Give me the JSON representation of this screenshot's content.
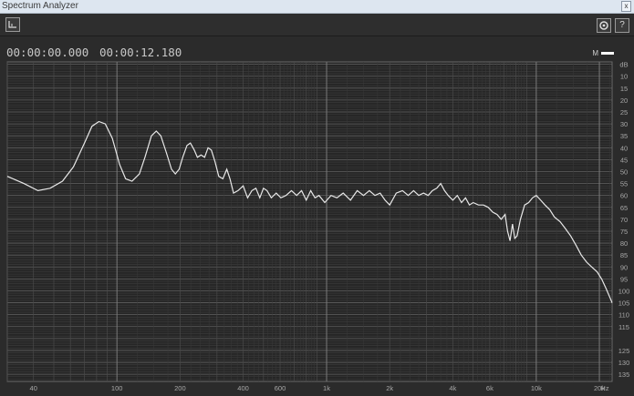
{
  "window": {
    "title": "Spectrum Analyzer",
    "close_label": "x"
  },
  "toolbar": {
    "left_icon": "waveform-icon",
    "settings_icon": "gear-icon",
    "help_label": "?"
  },
  "readout": {
    "start_time": "00:00:00.000",
    "end_time": "00:00:12.180"
  },
  "legend": {
    "label": "M"
  },
  "colors": {
    "background": "#2b2b2b",
    "grid": "#5c5c5c",
    "trace": "#e8e8e8",
    "label": "#a8a8a8"
  },
  "chart_data": {
    "type": "line",
    "x_scale": "log",
    "y_scale": "linear",
    "xlim": [
      30,
      23000
    ],
    "ylim": [
      -138,
      -4
    ],
    "x_ticks": [
      {
        "value": 40,
        "label": "40"
      },
      {
        "value": 100,
        "label": "100"
      },
      {
        "value": 200,
        "label": "200"
      },
      {
        "value": 400,
        "label": "400"
      },
      {
        "value": 600,
        "label": "600"
      },
      {
        "value": 1000,
        "label": "1k"
      },
      {
        "value": 2000,
        "label": "2k"
      },
      {
        "value": 4000,
        "label": "4k"
      },
      {
        "value": 6000,
        "label": "6k"
      },
      {
        "value": 10000,
        "label": "10k"
      },
      {
        "value": 20000,
        "label": "20k"
      }
    ],
    "x_unit": "Hz",
    "y_ticks": [
      {
        "value": -5,
        "label": "dB"
      },
      {
        "value": -10,
        "label": "10"
      },
      {
        "value": -15,
        "label": "15"
      },
      {
        "value": -20,
        "label": "20"
      },
      {
        "value": -25,
        "label": "25"
      },
      {
        "value": -30,
        "label": "30"
      },
      {
        "value": -35,
        "label": "35"
      },
      {
        "value": -40,
        "label": "40"
      },
      {
        "value": -45,
        "label": "45"
      },
      {
        "value": -50,
        "label": "50"
      },
      {
        "value": -55,
        "label": "55"
      },
      {
        "value": -60,
        "label": "60"
      },
      {
        "value": -65,
        "label": "65"
      },
      {
        "value": -70,
        "label": "70"
      },
      {
        "value": -75,
        "label": "75"
      },
      {
        "value": -80,
        "label": "80"
      },
      {
        "value": -85,
        "label": "85"
      },
      {
        "value": -90,
        "label": "90"
      },
      {
        "value": -95,
        "label": "95"
      },
      {
        "value": -100,
        "label": "100"
      },
      {
        "value": -105,
        "label": "105"
      },
      {
        "value": -110,
        "label": "110"
      },
      {
        "value": -115,
        "label": "115"
      },
      {
        "value": -125,
        "label": "125"
      },
      {
        "value": -130,
        "label": "130"
      },
      {
        "value": -135,
        "label": "135"
      }
    ],
    "grid": true,
    "series": [
      {
        "points": [
          [
            30,
            -52
          ],
          [
            36,
            -55
          ],
          [
            42,
            -58
          ],
          [
            48,
            -57
          ],
          [
            55,
            -54
          ],
          [
            62,
            -48
          ],
          [
            70,
            -38
          ],
          [
            76,
            -31
          ],
          [
            82,
            -29
          ],
          [
            88,
            -30
          ],
          [
            95,
            -36
          ],
          [
            103,
            -47
          ],
          [
            110,
            -53
          ],
          [
            118,
            -54
          ],
          [
            128,
            -51
          ],
          [
            136,
            -44
          ],
          [
            146,
            -35
          ],
          [
            154,
            -33
          ],
          [
            162,
            -35
          ],
          [
            172,
            -42
          ],
          [
            182,
            -49
          ],
          [
            190,
            -51
          ],
          [
            198,
            -49
          ],
          [
            206,
            -44
          ],
          [
            216,
            -39
          ],
          [
            224,
            -38
          ],
          [
            234,
            -41
          ],
          [
            242,
            -44
          ],
          [
            252,
            -43
          ],
          [
            262,
            -44
          ],
          [
            272,
            -40
          ],
          [
            282,
            -41
          ],
          [
            294,
            -46
          ],
          [
            306,
            -52
          ],
          [
            320,
            -53
          ],
          [
            334,
            -49
          ],
          [
            346,
            -53
          ],
          [
            360,
            -59
          ],
          [
            378,
            -58
          ],
          [
            400,
            -56
          ],
          [
            420,
            -61
          ],
          [
            440,
            -58
          ],
          [
            460,
            -57
          ],
          [
            480,
            -61
          ],
          [
            500,
            -57
          ],
          [
            520,
            -58
          ],
          [
            545,
            -61
          ],
          [
            575,
            -59
          ],
          [
            605,
            -61
          ],
          [
            640,
            -60
          ],
          [
            680,
            -58
          ],
          [
            720,
            -60
          ],
          [
            760,
            -58
          ],
          [
            800,
            -62
          ],
          [
            840,
            -58
          ],
          [
            880,
            -61
          ],
          [
            920,
            -60
          ],
          [
            980,
            -63
          ],
          [
            1050,
            -60
          ],
          [
            1120,
            -61
          ],
          [
            1200,
            -59
          ],
          [
            1300,
            -62
          ],
          [
            1400,
            -58
          ],
          [
            1500,
            -60
          ],
          [
            1600,
            -58
          ],
          [
            1700,
            -60
          ],
          [
            1800,
            -59
          ],
          [
            1900,
            -62
          ],
          [
            2000,
            -64
          ],
          [
            2150,
            -59
          ],
          [
            2300,
            -58
          ],
          [
            2450,
            -60
          ],
          [
            2600,
            -58
          ],
          [
            2750,
            -60
          ],
          [
            2900,
            -59
          ],
          [
            3050,
            -60
          ],
          [
            3200,
            -58
          ],
          [
            3350,
            -57
          ],
          [
            3500,
            -55
          ],
          [
            3650,
            -58
          ],
          [
            3800,
            -60
          ],
          [
            4000,
            -62
          ],
          [
            4200,
            -60
          ],
          [
            4400,
            -63
          ],
          [
            4600,
            -61
          ],
          [
            4800,
            -64
          ],
          [
            5000,
            -63
          ],
          [
            5300,
            -64
          ],
          [
            5600,
            -64
          ],
          [
            5900,
            -65
          ],
          [
            6200,
            -67
          ],
          [
            6500,
            -68
          ],
          [
            6800,
            -70
          ],
          [
            7100,
            -68
          ],
          [
            7300,
            -75
          ],
          [
            7500,
            -79
          ],
          [
            7700,
            -72
          ],
          [
            7900,
            -78
          ],
          [
            8100,
            -77
          ],
          [
            8400,
            -70
          ],
          [
            8800,
            -64
          ],
          [
            9200,
            -63
          ],
          [
            9600,
            -61
          ],
          [
            10000,
            -60
          ],
          [
            10500,
            -62
          ],
          [
            11000,
            -64
          ],
          [
            11600,
            -66
          ],
          [
            12200,
            -69
          ],
          [
            13000,
            -71
          ],
          [
            13800,
            -74
          ],
          [
            14600,
            -77
          ],
          [
            15500,
            -81
          ],
          [
            16400,
            -85
          ],
          [
            17400,
            -88
          ],
          [
            18400,
            -90
          ],
          [
            19500,
            -92
          ],
          [
            20500,
            -95
          ],
          [
            21500,
            -99
          ],
          [
            22500,
            -103
          ],
          [
            23000,
            -105
          ]
        ]
      }
    ]
  }
}
